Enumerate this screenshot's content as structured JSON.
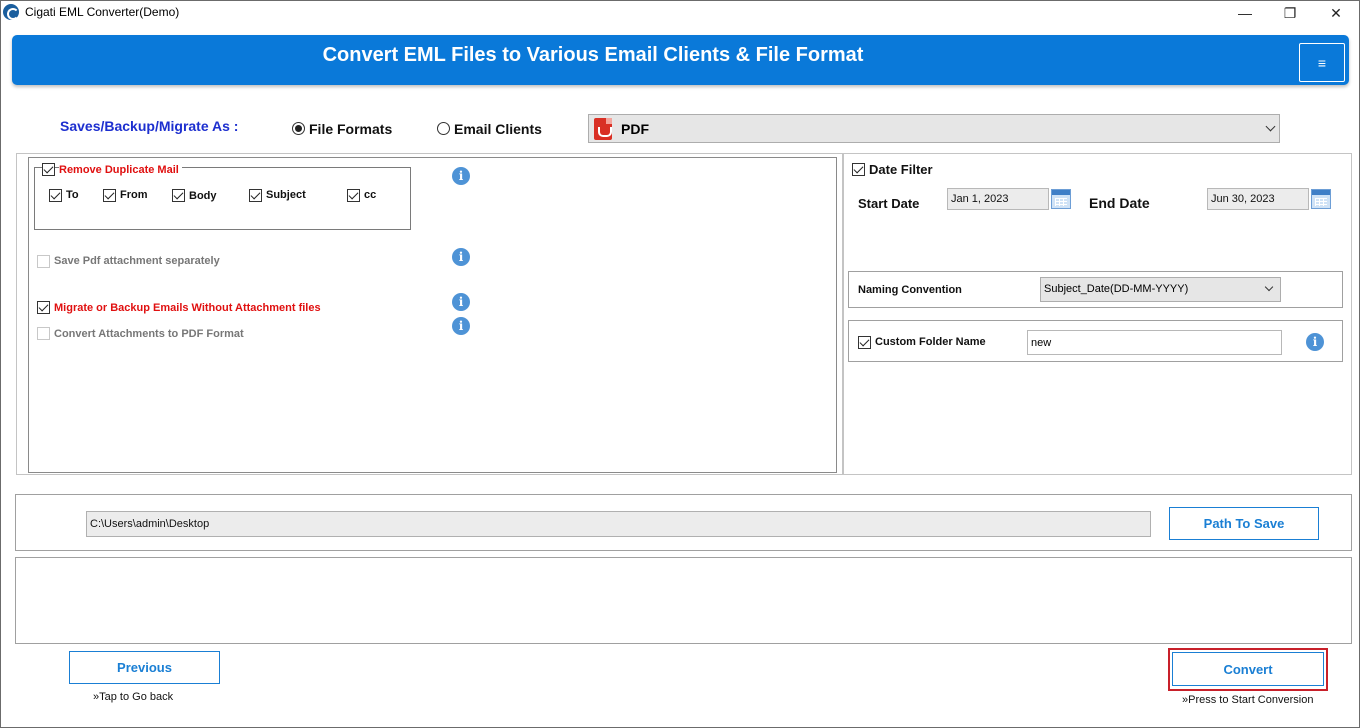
{
  "window": {
    "title": "Cigati EML Converter(Demo)",
    "minimize": "—",
    "maximize": "❐",
    "close": "✕"
  },
  "banner": {
    "title": "Convert EML Files to Various Email Clients & File Format",
    "menu_icon": "≡"
  },
  "saves": {
    "label": "Saves/Backup/Migrate As :",
    "options": [
      {
        "label": "File Formats",
        "selected": true
      },
      {
        "label": "Email Clients",
        "selected": false
      }
    ],
    "format_selected": "PDF"
  },
  "options_panel": {
    "remove_duplicate": {
      "label": "Remove Duplicate Mail",
      "checked": true
    },
    "duplicate_fields": [
      {
        "label": "To",
        "checked": true
      },
      {
        "label": "From",
        "checked": true
      },
      {
        "label": "Body",
        "checked": true
      },
      {
        "label": "Subject",
        "checked": true
      },
      {
        "label": "cc",
        "checked": true
      }
    ],
    "save_pdf_attachment": {
      "label": "Save Pdf attachment separately",
      "checked": false
    },
    "migrate_without_attachment": {
      "label": "Migrate or Backup Emails Without Attachment files",
      "checked": true
    },
    "convert_attachments_pdf": {
      "label": "Convert Attachments to PDF Format",
      "checked": false
    },
    "info_glyph": "i"
  },
  "date_filter": {
    "label": "Date Filter",
    "checked": true,
    "start_label": "Start Date",
    "start_value": "Jan 1, 2023",
    "end_label": "End Date",
    "end_value": "Jun 30, 2023"
  },
  "naming": {
    "label": "Naming Convention",
    "selected": "Subject_Date(DD-MM-YYYY)"
  },
  "custom_folder": {
    "label": "Custom Folder Name",
    "checked": true,
    "value": "new"
  },
  "path": {
    "value": "C:\\Users\\admin\\Desktop",
    "button_label": "Path To Save"
  },
  "footer": {
    "previous_label": "Previous",
    "previous_hint": "»Tap to Go back",
    "convert_label": "Convert",
    "convert_hint": "»Press to Start Conversion"
  },
  "colors": {
    "banner": "#0a79d9",
    "accent_blue": "#1a7fd4",
    "label_red": "#e01010",
    "saves_label": "#1d2fcf",
    "highlight_red": "#c8202a"
  }
}
